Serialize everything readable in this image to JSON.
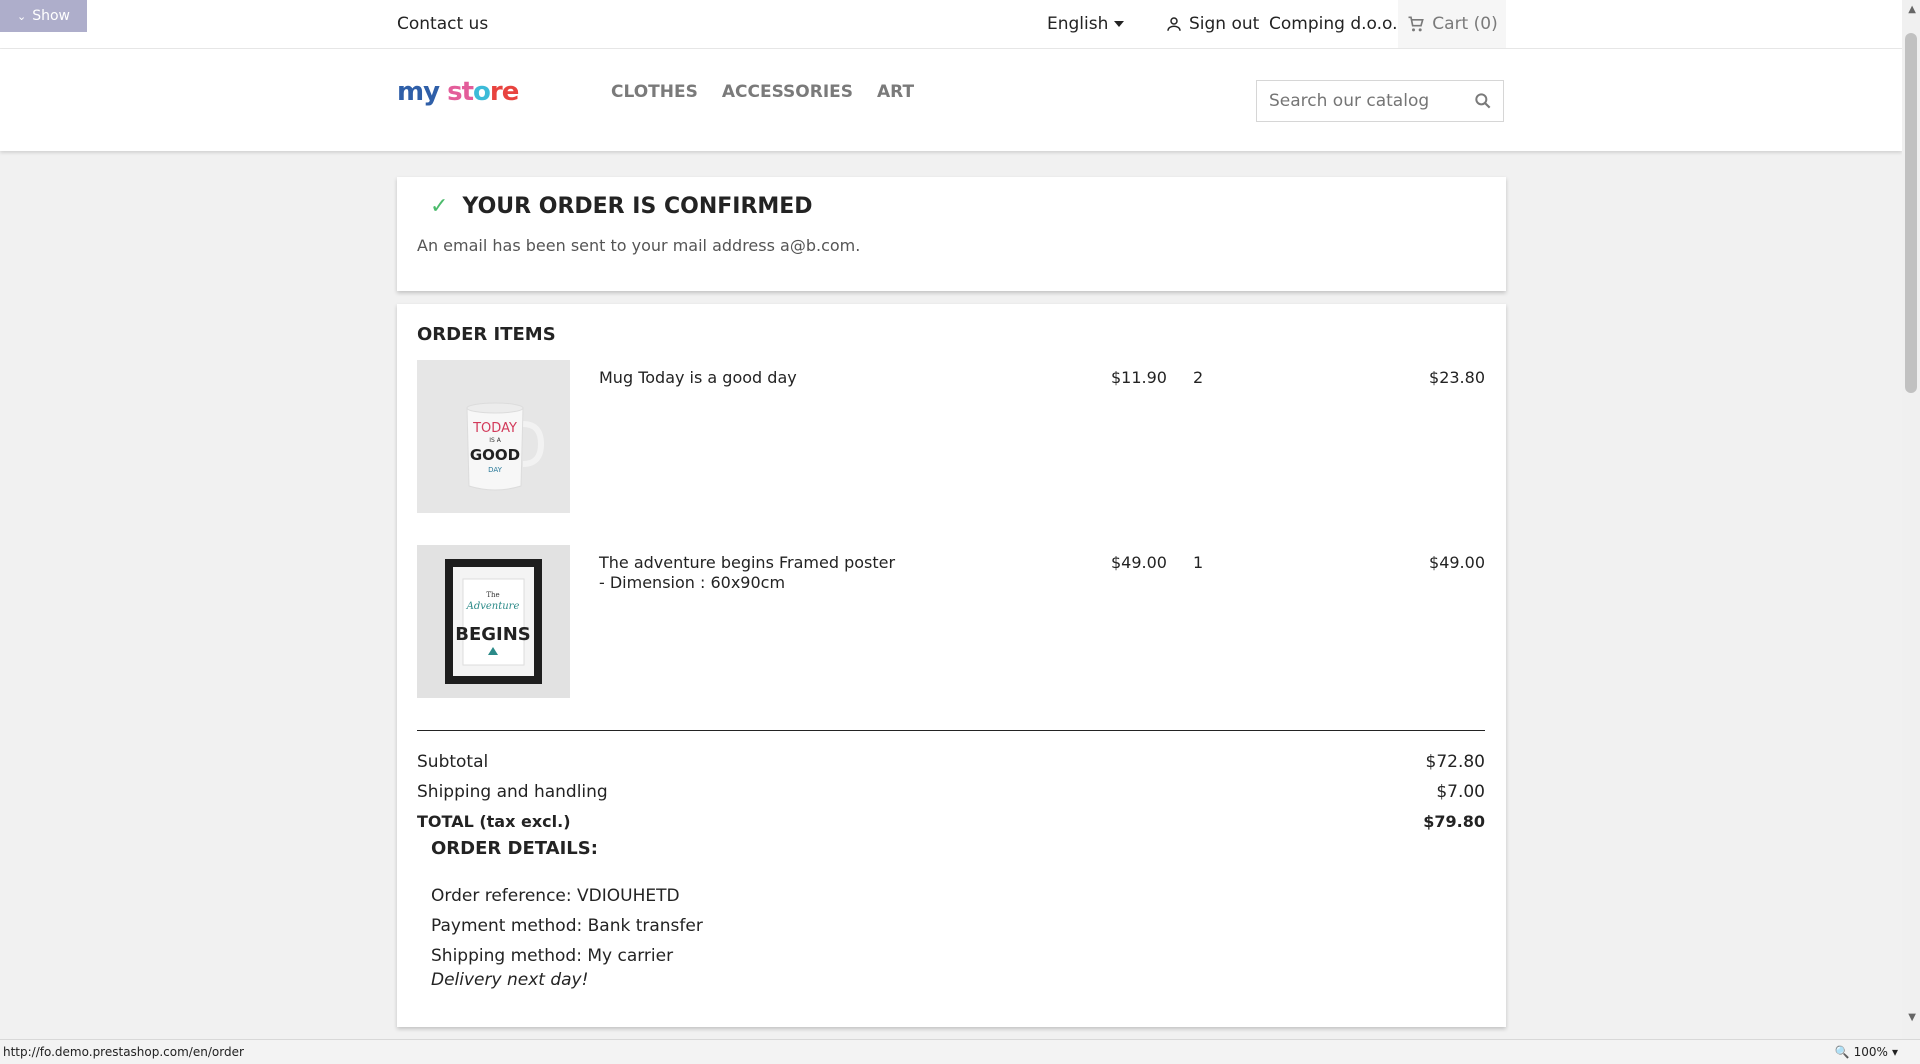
{
  "show_button": {
    "label": "Show"
  },
  "topbar": {
    "contact": "Contact us",
    "language": "English",
    "sign_out": "Sign out",
    "company": "Comping d.o.o.",
    "cart": "Cart (0)"
  },
  "header": {
    "logo_parts": [
      "my",
      " ",
      "st",
      "o",
      "re"
    ],
    "menu": [
      "CLOTHES",
      "ACCESSORIES",
      "ART"
    ],
    "search_placeholder": "Search our catalog"
  },
  "confirmation": {
    "title": "YOUR ORDER IS CONFIRMED",
    "message": "An email has been sent to your mail address a@b.com."
  },
  "order_items": {
    "title": "ORDER ITEMS",
    "items": [
      {
        "name": "Mug Today is a good day",
        "price": "$11.90",
        "qty": "2",
        "total": "$23.80"
      },
      {
        "name": "The adventure begins Framed poster - Dimension : 60x90cm",
        "price": "$49.00",
        "qty": "1",
        "total": "$49.00"
      }
    ],
    "subtotal_label": "Subtotal",
    "subtotal": "$72.80",
    "shipping_label": "Shipping and handling",
    "shipping": "$7.00",
    "total_label": "TOTAL (tax excl.)",
    "total": "$79.80"
  },
  "order_details": {
    "title": "ORDER DETAILS:",
    "reference": "Order reference: VDIOUHETD",
    "payment": "Payment method: Bank transfer",
    "shipping": "Shipping method: My carrier",
    "delivery": "Delivery next day!"
  },
  "mug_art": [
    "TODAY",
    "IS A",
    "GOOD",
    "DAY"
  ],
  "poster_art": [
    "The",
    "Adventure",
    "BEGINS"
  ],
  "statusbar": {
    "url": "http://fo.demo.prestashop.com/en/order",
    "zoom": "100%"
  },
  "colors": {
    "accent": "#24b9d7",
    "check": "#4cbb6c",
    "show_button": "#aeaecb"
  }
}
